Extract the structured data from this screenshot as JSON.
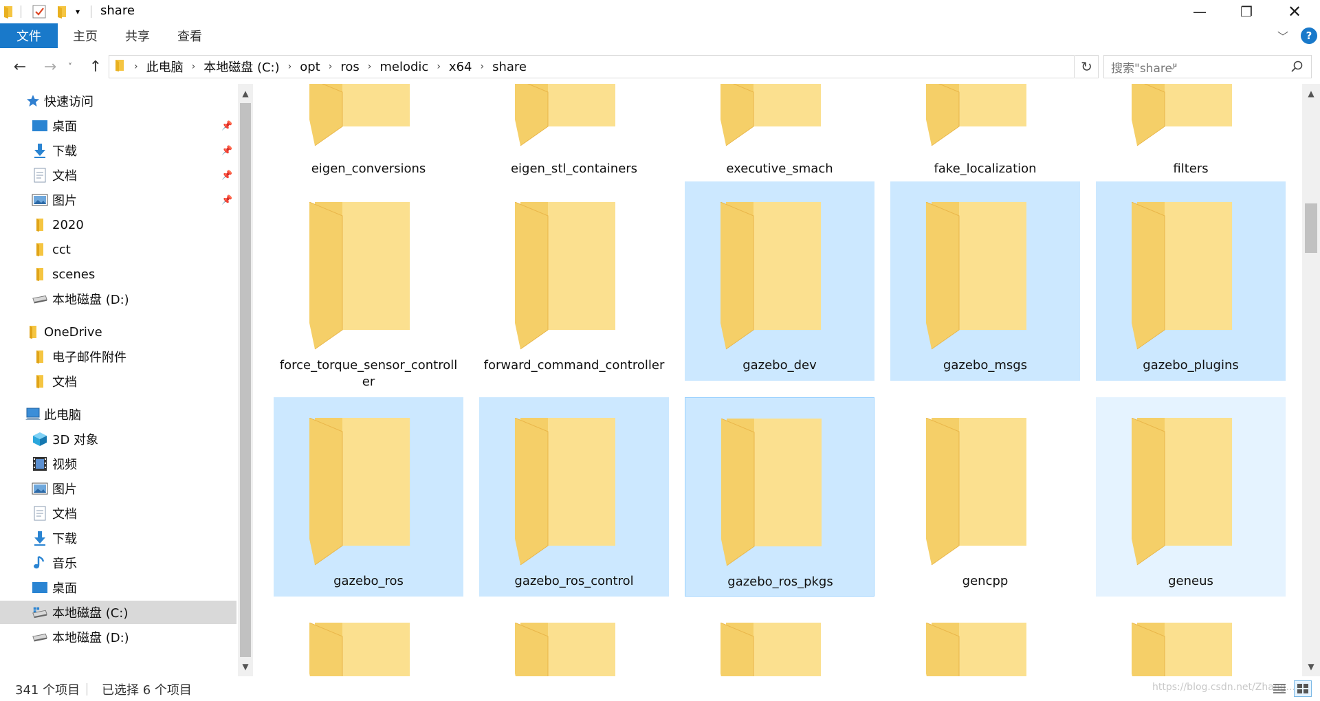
{
  "window": {
    "title": "share",
    "controls": {
      "minimize": "—",
      "maximize": "❐",
      "close": "✕"
    }
  },
  "ribbon": {
    "tabs": [
      "文件",
      "主页",
      "共享",
      "查看"
    ],
    "help": "?"
  },
  "address": {
    "crumbs": [
      "此电脑",
      "本地磁盘 (C:)",
      "opt",
      "ros",
      "melodic",
      "x64",
      "share"
    ],
    "separator": "›",
    "search_placeholder": "搜索\"share\""
  },
  "sidebar": {
    "quick_access": "快速访问",
    "quick_items": [
      "桌面",
      "下载",
      "文档",
      "图片",
      "2020",
      "cct",
      "scenes",
      "本地磁盘 (D:)"
    ],
    "onedrive": "OneDrive",
    "onedrive_items": [
      "电子邮件附件",
      "文档"
    ],
    "this_pc": "此电脑",
    "pc_items": [
      "3D 对象",
      "视频",
      "图片",
      "文档",
      "下载",
      "音乐",
      "桌面",
      "本地磁盘 (C:)",
      "本地磁盘 (D:)"
    ],
    "selected": "本地磁盘 (C:)"
  },
  "folders": [
    {
      "name": "eigen_conversions",
      "state": "normal"
    },
    {
      "name": "eigen_stl_containers",
      "state": "normal"
    },
    {
      "name": "executive_smach",
      "state": "normal"
    },
    {
      "name": "fake_localization",
      "state": "normal"
    },
    {
      "name": "filters",
      "state": "normal"
    },
    {
      "name": "force_torque_sensor_controller",
      "state": "normal"
    },
    {
      "name": "forward_command_controller",
      "state": "normal"
    },
    {
      "name": "gazebo_dev",
      "state": "selected"
    },
    {
      "name": "gazebo_msgs",
      "state": "selected"
    },
    {
      "name": "gazebo_plugins",
      "state": "selected"
    },
    {
      "name": "gazebo_ros",
      "state": "selected"
    },
    {
      "name": "gazebo_ros_control",
      "state": "selected"
    },
    {
      "name": "gazebo_ros_pkgs",
      "state": "selected-focus"
    },
    {
      "name": "gencpp",
      "state": "normal"
    },
    {
      "name": "geneus",
      "state": "hover"
    }
  ],
  "status": {
    "item_count": "341 个项目",
    "selected_count": "已选择 6 个项目",
    "watermark": "https://blog.csdn.net/Zhang..."
  },
  "colors": {
    "accent": "#1979ca",
    "selection": "#cce8ff",
    "selection_border": "#99d1ff",
    "hover": "#e5f3ff",
    "folder_back": "#f5cf68",
    "folder_front": "#fbe08f"
  }
}
